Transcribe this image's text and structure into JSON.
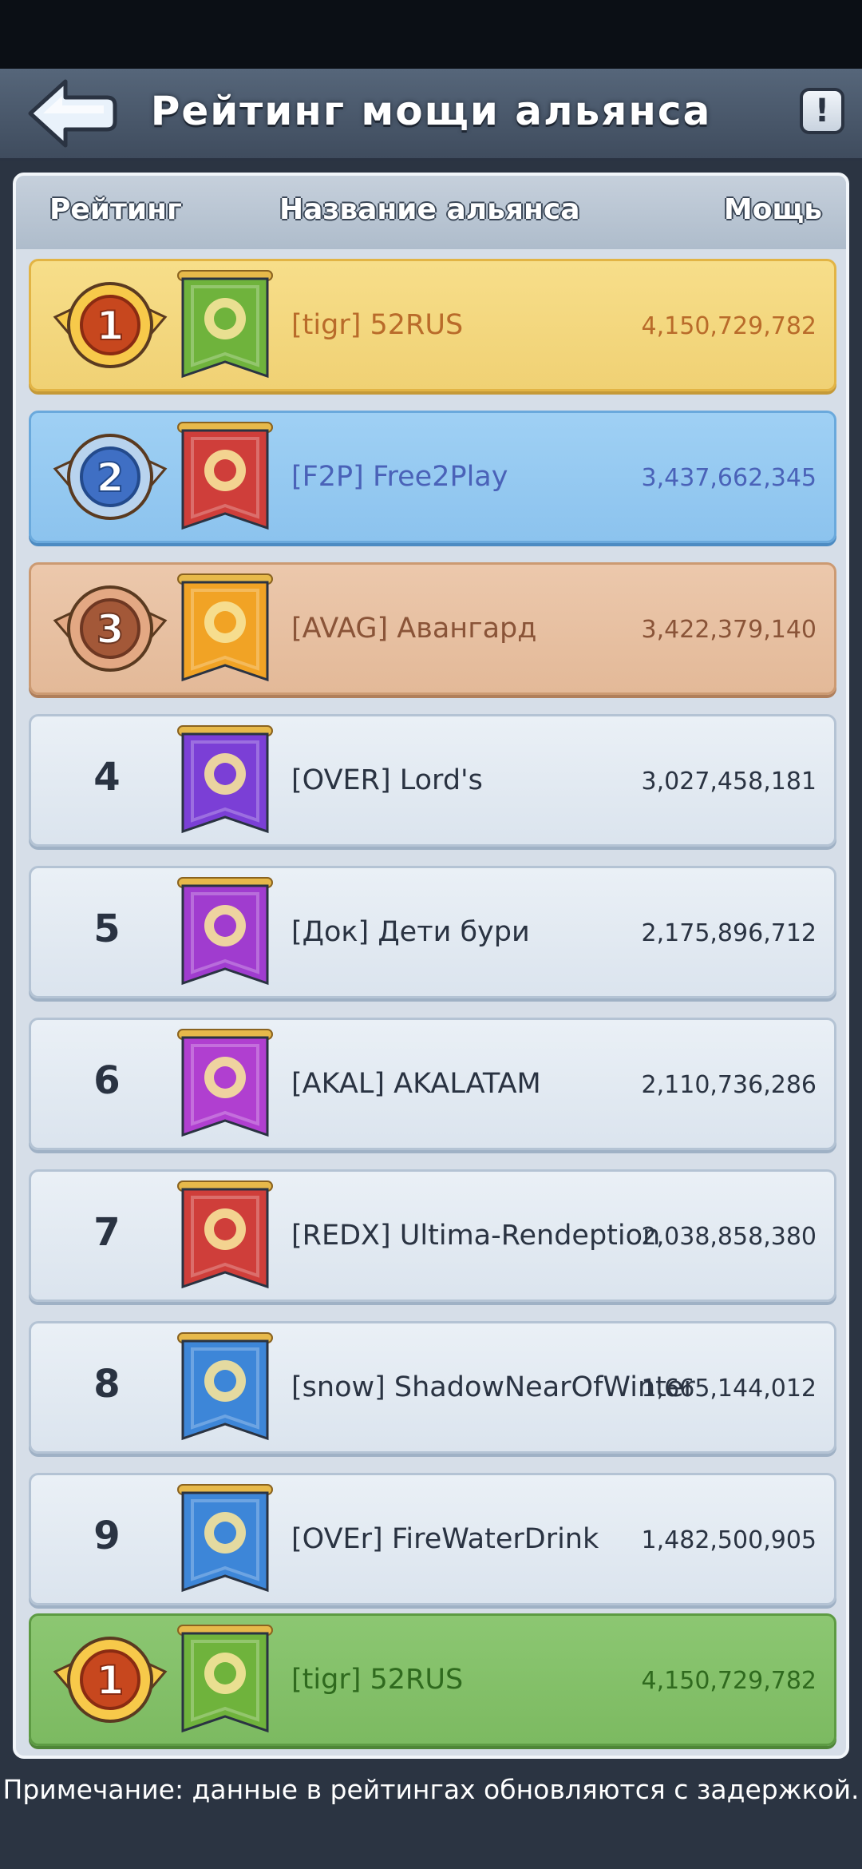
{
  "header": {
    "title": "Рейтинг мощи альянса",
    "info_label": "!"
  },
  "columns": {
    "rank": "Рейтинг",
    "name": "Название альянса",
    "power": "Мощь"
  },
  "rows": [
    {
      "rank": "1",
      "name": "[tigr] 52RUS",
      "power": "4,150,729,782",
      "style": "gold",
      "banner_color": "#6fb33c",
      "emblem": "shield-sword-icon"
    },
    {
      "rank": "2",
      "name": "[F2P] Free2Play",
      "power": "3,437,662,345",
      "style": "blue",
      "banner_color": "#cf3e3a",
      "emblem": "winged-scales-icon"
    },
    {
      "rank": "3",
      "name": "[AVAG] Авангард",
      "power": "3,422,379,140",
      "style": "bronze",
      "banner_color": "#f1a325",
      "emblem": "eagle-icon"
    },
    {
      "rank": "4",
      "name": "[OVER] Lord's",
      "power": "3,027,458,181",
      "style": "plain",
      "banner_color": "#7b3fd6",
      "emblem": "eye-icon"
    },
    {
      "rank": "5",
      "name": "[Док] Дети бури",
      "power": "2,175,896,712",
      "style": "plain",
      "banner_color": "#a03ccf",
      "emblem": "bird-head-icon"
    },
    {
      "rank": "6",
      "name": "[AKAL] AKALATAM",
      "power": "2,110,736,286",
      "style": "plain",
      "banner_color": "#b03fd0",
      "emblem": "crown-icon"
    },
    {
      "rank": "7",
      "name": "[REDX] Ultima-Rendeption",
      "power": "2,038,858,380",
      "style": "plain",
      "banner_color": "#cf3e3a",
      "emblem": "winged-scales-icon"
    },
    {
      "rank": "8",
      "name": "[snow] ShadowNearOfWinter",
      "power": "1,665,144,012",
      "style": "plain",
      "banner_color": "#3d86d8",
      "emblem": "snowflake-key-icon"
    },
    {
      "rank": "9",
      "name": "[OVEr] FireWaterDrink",
      "power": "1,482,500,905",
      "style": "plain",
      "banner_color": "#3d86d8",
      "emblem": "lantern-icon"
    }
  ],
  "my_alliance": {
    "rank": "1",
    "name": "[tigr] 52RUS",
    "power": "4,150,729,782",
    "style": "mine",
    "banner_color": "#6fb33c",
    "emblem": "shield-sword-icon"
  },
  "footer": {
    "note": "Примечание: данные в рейтингах обновляются с задержкой."
  },
  "colors": {
    "gold_row": "#f0d174",
    "silver_row": "#8cc3ee",
    "bronze_row": "#e3b998",
    "my_row": "#7cba61",
    "header_bg": "#4a586b"
  }
}
